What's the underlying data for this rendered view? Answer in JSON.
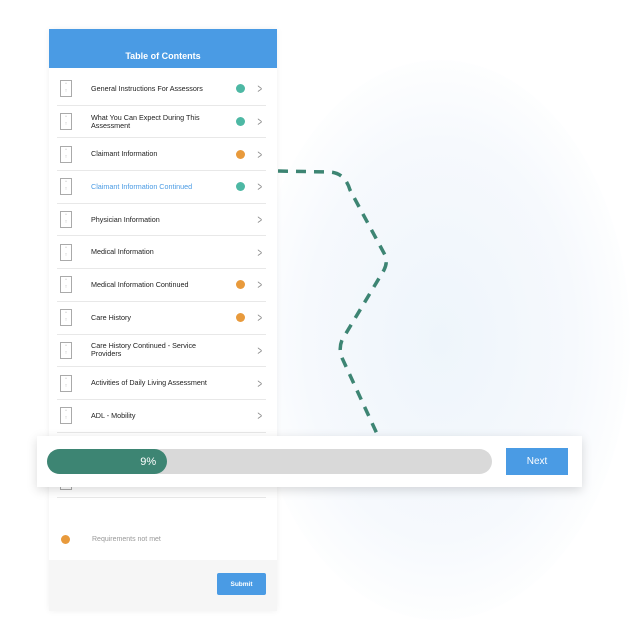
{
  "header": {
    "title": "Table of Contents"
  },
  "colors": {
    "complete": "#4db8a4",
    "incomplete": "#e89a3c",
    "accent": "#4a9be4",
    "progress": "#3d8573"
  },
  "items": [
    {
      "label": "General Instructions For Assessors",
      "status": "complete"
    },
    {
      "label": "What You Can Expect During This Assessment",
      "status": "complete"
    },
    {
      "label": "Claimant Information",
      "status": "incomplete"
    },
    {
      "label": "Claimant Information Continued",
      "status": "complete",
      "active": true
    },
    {
      "label": "Physician Information",
      "status": ""
    },
    {
      "label": "Medical Information",
      "status": ""
    },
    {
      "label": "Medical Information Continued",
      "status": "incomplete"
    },
    {
      "label": "Care History",
      "status": "incomplete"
    },
    {
      "label": "Care History Continued - Service Providers",
      "status": ""
    },
    {
      "label": "Activities of Daily Living Assessment",
      "status": ""
    },
    {
      "label": "ADL - Mobility",
      "status": ""
    },
    {
      "label": "",
      "status": ""
    },
    {
      "label": "ADL - Ambulation",
      "status": ""
    }
  ],
  "legend": {
    "label": "Requirements not met"
  },
  "footer": {
    "submit_label": "Submit"
  },
  "progress": {
    "percent": 9,
    "label": "9%",
    "next_label": "Next"
  }
}
